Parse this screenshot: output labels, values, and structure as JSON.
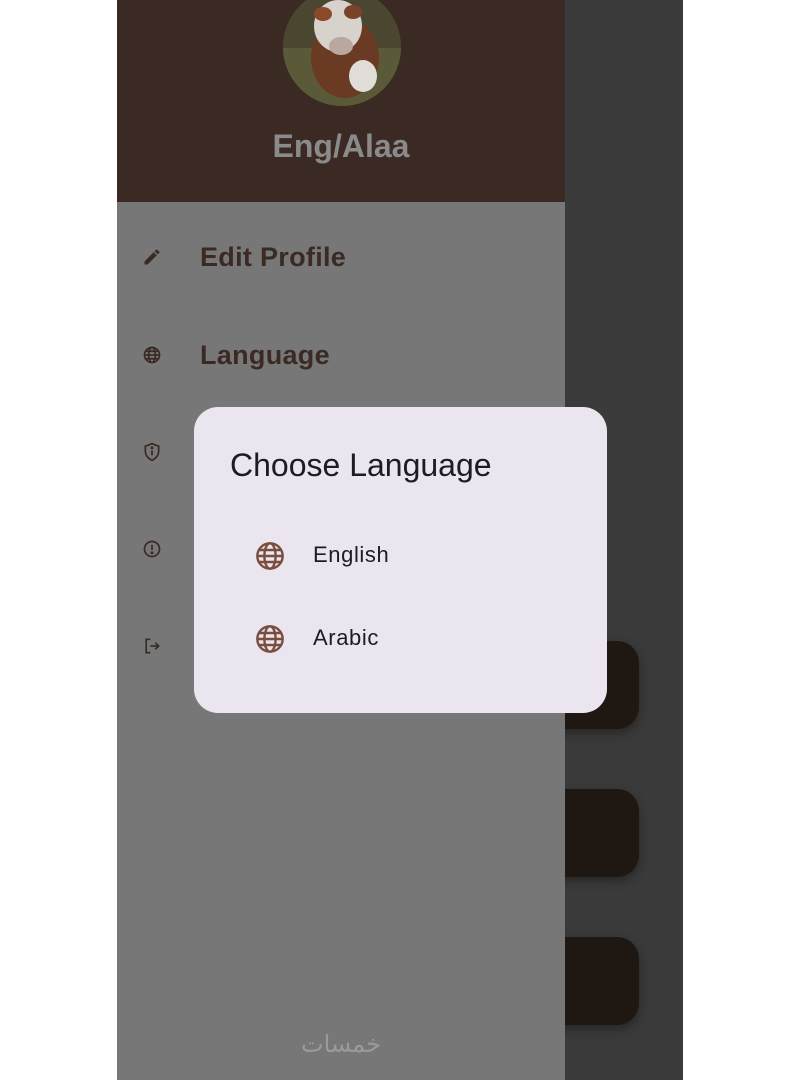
{
  "drawer": {
    "user_name": "Eng/Alaa",
    "avatar_icon": "cow-profile-photo",
    "items": [
      {
        "label": "Edit Profile",
        "icon": "pencil-icon"
      },
      {
        "label": "Language",
        "icon": "globe-icon"
      },
      {
        "label": "",
        "icon": "shield-info-icon"
      },
      {
        "label": "",
        "icon": "alert-circle-icon"
      },
      {
        "label": "",
        "icon": "logout-icon"
      }
    ],
    "watermark": "خمسات"
  },
  "dialog": {
    "title": "Choose Language",
    "options": [
      {
        "label": "English",
        "icon": "globe-icon"
      },
      {
        "label": "Arabic",
        "icon": "globe-icon"
      }
    ]
  },
  "colors": {
    "drawer_header": "#3a2a23",
    "drawer_body": "#777777",
    "dialog_bg": "#ebe5ef",
    "icon_accent": "#7a4e3e",
    "scrim": "#3a3a3a"
  }
}
